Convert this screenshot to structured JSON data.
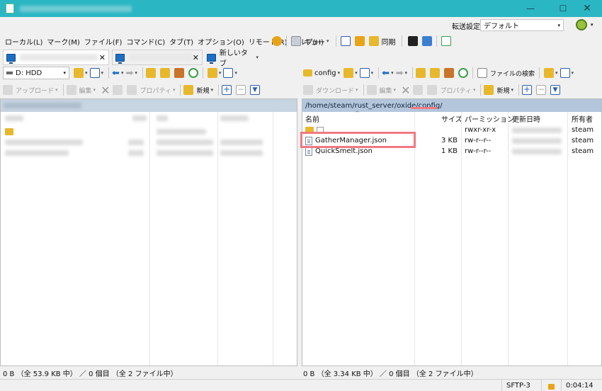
{
  "transfer_settings": {
    "label": "転送設定",
    "value": "デフォルト"
  },
  "menu": [
    "ローカル(L)",
    "マーク(M)",
    "ファイル(F)",
    "コマンド(C)",
    "タブ(T)",
    "オプション(O)",
    "リモート(R)",
    "ヘルプ(H)"
  ],
  "toolbar": {
    "queue_label": "キュー",
    "sync_label": "同期"
  },
  "tabs": {
    "new_tab": "新しいタブ"
  },
  "left": {
    "drive": "D: HDD",
    "upload": "アップロード",
    "edit": "編集",
    "properties": "プロパティ",
    "new": "新規",
    "status": "0 B （全 53.9 KB 中） ／ 0 個目 （全 2 ファイル中）"
  },
  "right": {
    "folder": "config",
    "search_files": "ファイルの検索",
    "download": "ダウンロード",
    "edit": "編集",
    "properties": "プロパティ",
    "new": "新規",
    "path": "/home/steam/rust_server/oxide/config/",
    "columns": {
      "name": "名前",
      "size": "サイズ",
      "permission": "パーミッション",
      "modified": "更新日時",
      "owner": "所有者"
    },
    "rows": [
      {
        "name": "..",
        "size": "",
        "permission": "rwxr-xr-x",
        "owner": "steam"
      },
      {
        "name": "GatherManager.json",
        "size": "3 KB",
        "permission": "rw-r--r--",
        "owner": "steam"
      },
      {
        "name": "QuickSmelt.json",
        "size": "1 KB",
        "permission": "rw-r--r--",
        "owner": "steam"
      }
    ],
    "status": "0 B （全 3.34 KB 中） ／ 0 個目 （全 2 ファイル中）"
  },
  "statusbar": {
    "protocol": "SFTP-3",
    "time": "0:04:14"
  },
  "colors": {
    "titlebar": "#2bb6c3",
    "path_bar": "#b3c6dc",
    "highlight": "#f07a80"
  }
}
